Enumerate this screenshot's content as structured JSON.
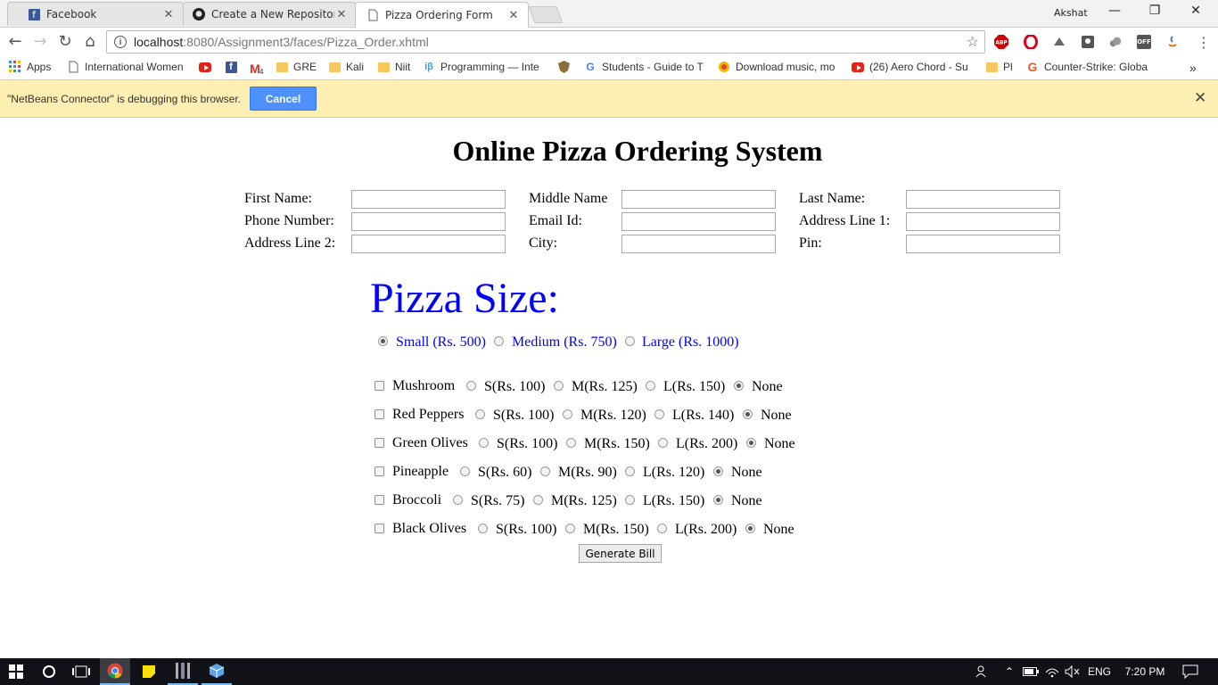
{
  "browser": {
    "tabs": [
      {
        "label": "Facebook",
        "icon": "facebook-icon",
        "active": false
      },
      {
        "label": "Create a New Repository",
        "icon": "github-icon",
        "active": false
      },
      {
        "label": "Pizza Ordering Form",
        "icon": "page-icon",
        "active": true
      }
    ],
    "profile_name": "Akshat",
    "url_host": "localhost",
    "url_rest": ":8080/Assignment3/faces/Pizza_Order.xhtml",
    "extensions": [
      "ABP",
      "OFF"
    ],
    "bookmarks": [
      {
        "label": "Apps",
        "icon": "apps-grid-icon"
      },
      {
        "label": "International Women",
        "icon": "page-icon"
      },
      {
        "label": "",
        "icon": "youtube-icon"
      },
      {
        "label": "",
        "icon": "facebook-icon"
      },
      {
        "label": "4",
        "icon": "gmail-icon"
      },
      {
        "label": "GRE",
        "icon": "folder-icon"
      },
      {
        "label": "Kali",
        "icon": "folder-icon"
      },
      {
        "label": "Niit",
        "icon": "folder-icon"
      },
      {
        "label": "Programming — Inte",
        "icon": "ib-icon"
      },
      {
        "label": "",
        "icon": "shield-icon"
      },
      {
        "label": "Students - Guide to T",
        "icon": "google-icon"
      },
      {
        "label": "Download music, mo",
        "icon": "music-icon"
      },
      {
        "label": "(26) Aero Chord - Su",
        "icon": "youtube-icon"
      },
      {
        "label": "Pl",
        "icon": "folder-icon"
      },
      {
        "label": "Counter-Strike: Globa",
        "icon": "g2a-icon"
      }
    ],
    "more_bookmarks": "»"
  },
  "infobar": {
    "message": "\"NetBeans Connector\" is debugging this browser.",
    "cancel_label": "Cancel"
  },
  "page": {
    "heading": "Online Pizza Ordering System",
    "fields": [
      {
        "label": "First Name:",
        "value": ""
      },
      {
        "label": "Middle Name",
        "value": ""
      },
      {
        "label": "Last Name:",
        "value": ""
      },
      {
        "label": "Phone Number:",
        "value": ""
      },
      {
        "label": "Email Id:",
        "value": ""
      },
      {
        "label": "Address Line 1:",
        "value": ""
      },
      {
        "label": "Address Line 2:",
        "value": ""
      },
      {
        "label": "City:",
        "value": ""
      },
      {
        "label": "Pin:",
        "value": ""
      }
    ],
    "size_title": "Pizza Size:",
    "sizes": [
      {
        "label": "Small (Rs. 500)",
        "selected": true
      },
      {
        "label": "Medium (Rs. 750)",
        "selected": false
      },
      {
        "label": "Large (Rs. 1000)",
        "selected": false
      }
    ],
    "toppings": [
      {
        "name": "Mushroom",
        "checked": false,
        "options": [
          "S(Rs. 100)",
          "M(Rs. 125)",
          "L(Rs. 150)",
          "None"
        ],
        "selected": "None"
      },
      {
        "name": "Red Peppers",
        "checked": false,
        "options": [
          "S(Rs. 100)",
          "M(Rs. 120)",
          "L(Rs. 140)",
          "None"
        ],
        "selected": "None"
      },
      {
        "name": "Green Olives",
        "checked": false,
        "options": [
          "S(Rs. 100)",
          "M(Rs. 150)",
          "L(Rs. 200)",
          "None"
        ],
        "selected": "None"
      },
      {
        "name": "Pineapple",
        "checked": false,
        "options": [
          "S(Rs. 60)",
          "M(Rs. 90)",
          "L(Rs. 120)",
          "None"
        ],
        "selected": "None"
      },
      {
        "name": "Broccoli",
        "checked": false,
        "options": [
          "S(Rs. 75)",
          "M(Rs. 125)",
          "L(Rs. 150)",
          "None"
        ],
        "selected": "None"
      },
      {
        "name": "Black Olives",
        "checked": false,
        "options": [
          "S(Rs. 100)",
          "M(Rs. 150)",
          "L(Rs. 200)",
          "None"
        ],
        "selected": "None"
      }
    ],
    "generate_label": "Generate Bill"
  },
  "taskbar": {
    "language": "ENG",
    "time": "7:20 PM"
  }
}
